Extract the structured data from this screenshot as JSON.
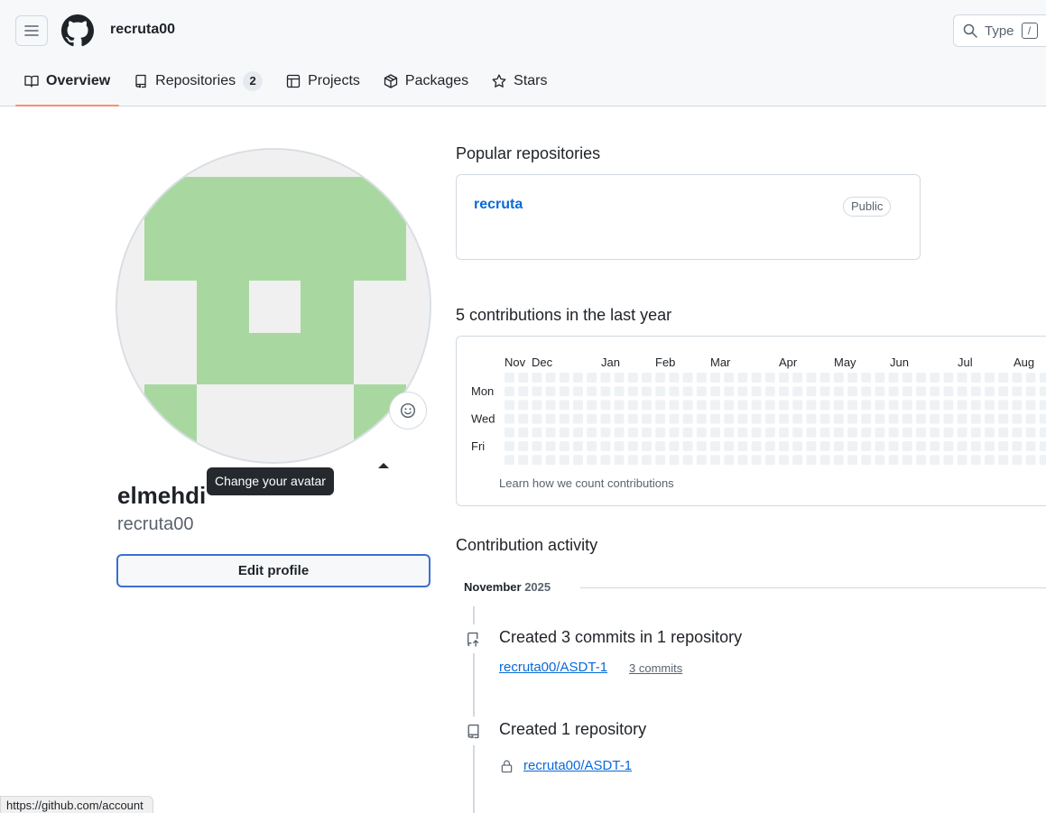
{
  "header": {
    "username": "recruta00",
    "search_placeholder": "Type",
    "search_shortcut": "/"
  },
  "tabs": [
    {
      "label": "Overview",
      "selected": true,
      "icon": "book-icon"
    },
    {
      "label": "Repositories",
      "count": "2",
      "icon": "repo-icon"
    },
    {
      "label": "Projects",
      "icon": "table-icon"
    },
    {
      "label": "Packages",
      "icon": "package-icon"
    },
    {
      "label": "Stars",
      "icon": "star-icon"
    }
  ],
  "profile": {
    "display_name": "elmehdi",
    "login": "recruta00",
    "edit_button": "Edit profile",
    "avatar_tooltip": "Change your avatar",
    "avatar_colors": {
      "fg": "#a8d8a0",
      "bg": "#f0f0f0"
    }
  },
  "popular": {
    "title": "Popular repositories",
    "repos": [
      {
        "name": "recruta",
        "visibility": "Public"
      }
    ]
  },
  "contributions": {
    "title": "5 contributions in the last year",
    "months": [
      "Nov",
      "Dec",
      "Jan",
      "Feb",
      "Mar",
      "Apr",
      "May",
      "Jun",
      "Jul",
      "Aug"
    ],
    "weekdays": [
      "Mon",
      "Wed",
      "Fri"
    ],
    "learn_link": "Learn how we count contributions",
    "cell_color": "#eff2f5"
  },
  "activity": {
    "title": "Contribution activity",
    "month": "November",
    "year": "2025",
    "items": [
      {
        "title": "Created 3 commits in 1 repository",
        "repo": "recruta00/ASDT-1",
        "count": "3 commits",
        "icon": "repo-push-icon"
      },
      {
        "title": "Created 1 repository",
        "repo": "recruta00/ASDT-1",
        "icon": "repo-icon"
      }
    ]
  },
  "status_bar": {
    "url": "https://github.com/account"
  }
}
